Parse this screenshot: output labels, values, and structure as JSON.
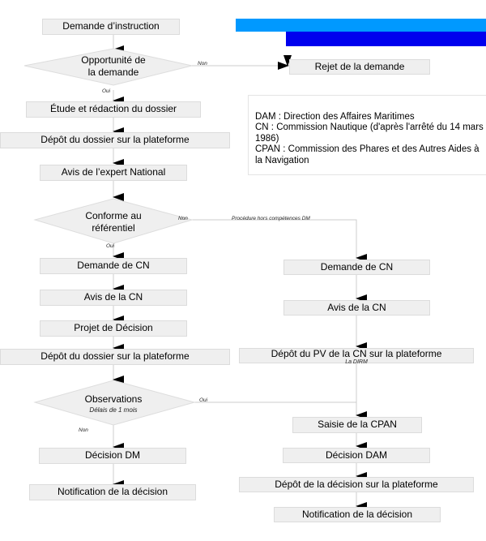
{
  "colors": {
    "bar_light": "#0099ff",
    "bar_dark": "#0000ee",
    "node_fill": "#efefef",
    "line": "#cccccc",
    "arrow": "#000000"
  },
  "left_flow": {
    "demande_instruction": "Demande d’instruction",
    "opportunite": [
      "Opportunité de",
      "la demande"
    ],
    "opportunite_non": "Non",
    "opportunite_oui": "Oui",
    "rejet": "Rejet de la demande",
    "etude": "Étude et rédaction du dossier",
    "depot1": "Dépôt du dossier sur la plateforme",
    "avis_expert": "Avis de l’expert National",
    "conforme": [
      "Conforme au",
      "référentiel"
    ],
    "conforme_non": "Non",
    "conforme_oui": "Oui",
    "hors_competences": "Procédure hors compétences DM",
    "demande_cn": "Demande de CN",
    "avis_cn": "Avis de la CN",
    "projet_decision": "Projet de Décision",
    "depot2": "Dépôt du dossier sur la plateforme",
    "observations": "Observations",
    "observations_sub": "Délais de 1 mois",
    "observations_oui": "Oui",
    "observations_non": "Non",
    "decision_dm": "Décision DM",
    "notification": "Notification de la décision"
  },
  "right_flow": {
    "demande_cn": "Demande de CN",
    "avis_cn": "Avis de la CN",
    "depot_pv": "Dépôt du PV de la CN sur la plateforme",
    "depot_pv_sub": "La DIRM",
    "saisie_cpan": "Saisie de la CPAN",
    "decision_dam": "Décision DAM",
    "depot_decision": "Dépôt de la décision sur la plateforme",
    "notification": "Notification de la décision"
  },
  "legend": [
    "DAM : Direction des Affaires Maritimes",
    "CN : Commission Nautique (d'après l'arrêté du 14 mars 1986)",
    "CPAN : Commission des Phares et des Autres Aides à la Navigation"
  ]
}
